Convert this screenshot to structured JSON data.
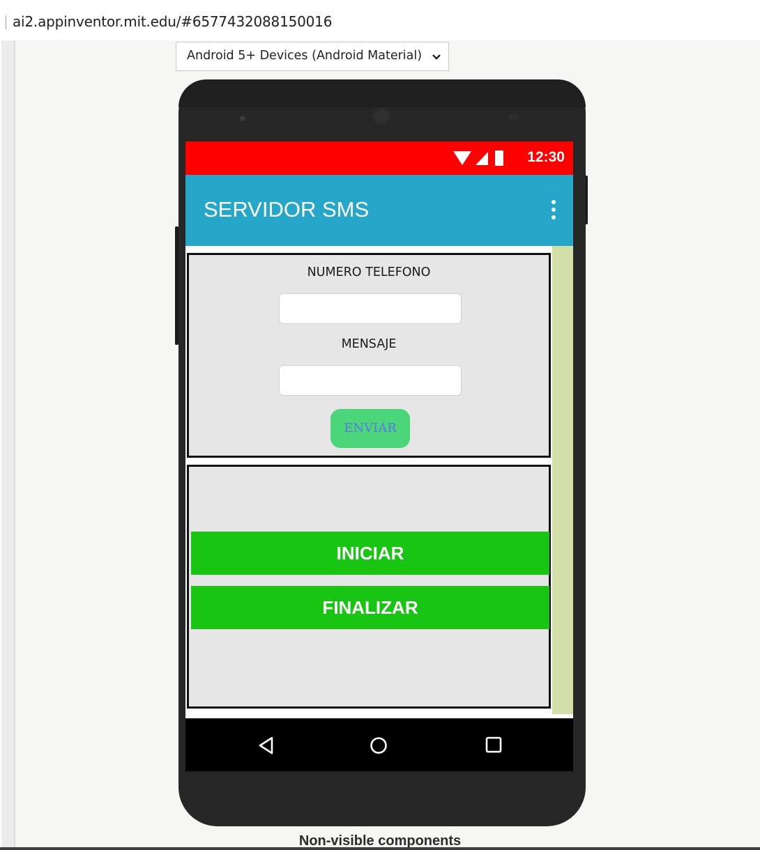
{
  "browser": {
    "url": "ai2.appinventor.mit.edu/#6577432088150016"
  },
  "device_select": {
    "selected": "Android 5+ Devices (Android Material)"
  },
  "statusbar": {
    "time": "12:30",
    "color": "#ff0000"
  },
  "appbar": {
    "title": "SERVIDOR SMS",
    "color": "#26a6c8",
    "menu_icon": "more-vert-icon"
  },
  "form": {
    "phone_label": "NUMERO TELEFONO",
    "phone_value": "",
    "message_label": "MENSAJE",
    "message_value": "",
    "send_button": "ENVIAR"
  },
  "controls": {
    "start_button": "INICIAR",
    "stop_button": "FINALIZAR",
    "button_color": "#18c512"
  },
  "navbar": {
    "icons": [
      "back-icon",
      "home-icon",
      "recents-icon"
    ]
  },
  "footer": {
    "label": "Non-visible components"
  }
}
